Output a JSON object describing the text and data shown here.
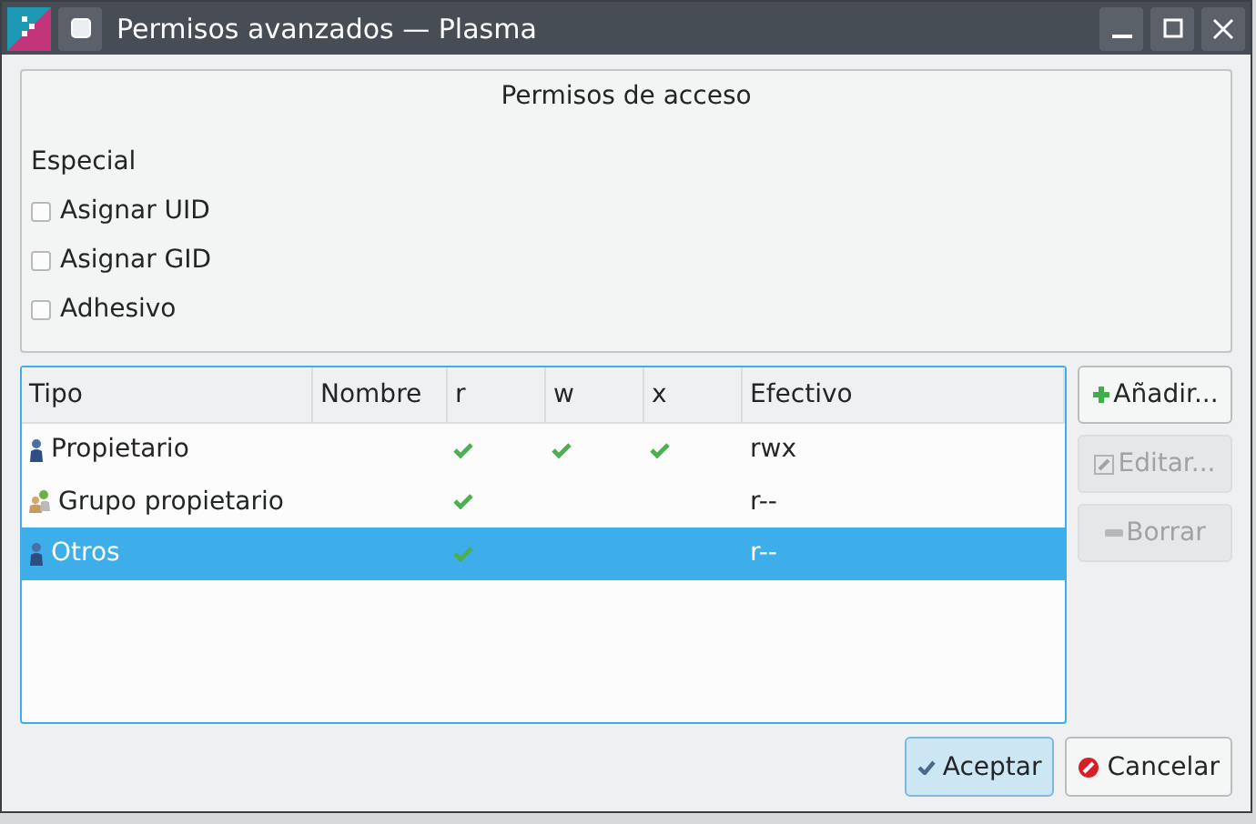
{
  "window": {
    "title": "Permisos avanzados — Plasma"
  },
  "access_group": {
    "title": "Permisos de acceso",
    "special_label": "Especial",
    "checkboxes": [
      {
        "label": "Asignar UID",
        "checked": false
      },
      {
        "label": "Asignar GID",
        "checked": false
      },
      {
        "label": "Adhesivo",
        "checked": false
      }
    ]
  },
  "table": {
    "columns": [
      "Tipo",
      "Nombre",
      "r",
      "w",
      "x",
      "Efectivo"
    ],
    "rows": [
      {
        "kind": "user",
        "tipo": "Propietario",
        "r": true,
        "w": true,
        "x": true,
        "efectivo": "rwx",
        "selected": false
      },
      {
        "kind": "group",
        "tipo": "Grupo propietario",
        "r": true,
        "w": false,
        "x": false,
        "efectivo": "r--",
        "selected": false
      },
      {
        "kind": "user",
        "tipo": "Otros",
        "r": true,
        "w": false,
        "x": false,
        "efectivo": "r--",
        "selected": true
      }
    ]
  },
  "side_buttons": [
    {
      "kind": "add",
      "label": "Añadir...",
      "disabled": false
    },
    {
      "kind": "edit",
      "label": "Editar...",
      "disabled": true
    },
    {
      "kind": "remove",
      "label": "Borrar",
      "disabled": true
    }
  ],
  "dialog_buttons": [
    {
      "kind": "ok",
      "label": "Aceptar",
      "default": true
    },
    {
      "kind": "cancel",
      "label": "Cancelar",
      "default": false
    }
  ]
}
